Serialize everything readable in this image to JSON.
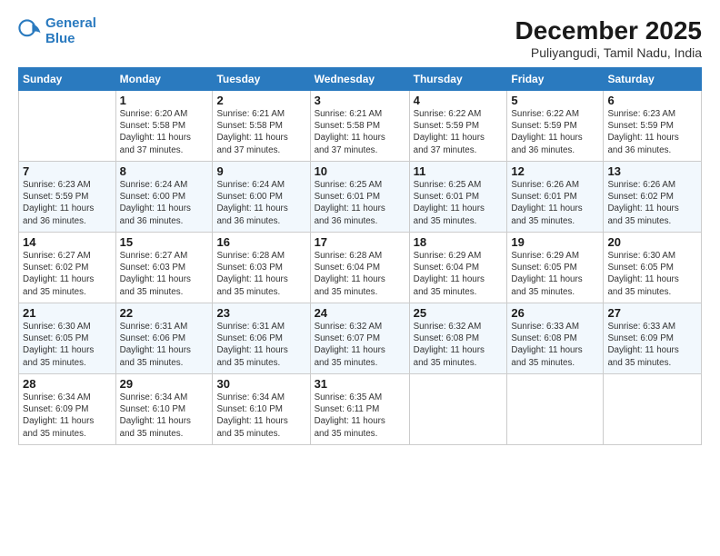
{
  "header": {
    "logo_line1": "General",
    "logo_line2": "Blue",
    "month": "December 2025",
    "location": "Puliyangudi, Tamil Nadu, India"
  },
  "days_of_week": [
    "Sunday",
    "Monday",
    "Tuesday",
    "Wednesday",
    "Thursday",
    "Friday",
    "Saturday"
  ],
  "weeks": [
    [
      {
        "day": "",
        "info": ""
      },
      {
        "day": "1",
        "info": "Sunrise: 6:20 AM\nSunset: 5:58 PM\nDaylight: 11 hours\nand 37 minutes."
      },
      {
        "day": "2",
        "info": "Sunrise: 6:21 AM\nSunset: 5:58 PM\nDaylight: 11 hours\nand 37 minutes."
      },
      {
        "day": "3",
        "info": "Sunrise: 6:21 AM\nSunset: 5:58 PM\nDaylight: 11 hours\nand 37 minutes."
      },
      {
        "day": "4",
        "info": "Sunrise: 6:22 AM\nSunset: 5:59 PM\nDaylight: 11 hours\nand 37 minutes."
      },
      {
        "day": "5",
        "info": "Sunrise: 6:22 AM\nSunset: 5:59 PM\nDaylight: 11 hours\nand 36 minutes."
      },
      {
        "day": "6",
        "info": "Sunrise: 6:23 AM\nSunset: 5:59 PM\nDaylight: 11 hours\nand 36 minutes."
      }
    ],
    [
      {
        "day": "7",
        "info": "Sunrise: 6:23 AM\nSunset: 5:59 PM\nDaylight: 11 hours\nand 36 minutes."
      },
      {
        "day": "8",
        "info": "Sunrise: 6:24 AM\nSunset: 6:00 PM\nDaylight: 11 hours\nand 36 minutes."
      },
      {
        "day": "9",
        "info": "Sunrise: 6:24 AM\nSunset: 6:00 PM\nDaylight: 11 hours\nand 36 minutes."
      },
      {
        "day": "10",
        "info": "Sunrise: 6:25 AM\nSunset: 6:01 PM\nDaylight: 11 hours\nand 36 minutes."
      },
      {
        "day": "11",
        "info": "Sunrise: 6:25 AM\nSunset: 6:01 PM\nDaylight: 11 hours\nand 35 minutes."
      },
      {
        "day": "12",
        "info": "Sunrise: 6:26 AM\nSunset: 6:01 PM\nDaylight: 11 hours\nand 35 minutes."
      },
      {
        "day": "13",
        "info": "Sunrise: 6:26 AM\nSunset: 6:02 PM\nDaylight: 11 hours\nand 35 minutes."
      }
    ],
    [
      {
        "day": "14",
        "info": "Sunrise: 6:27 AM\nSunset: 6:02 PM\nDaylight: 11 hours\nand 35 minutes."
      },
      {
        "day": "15",
        "info": "Sunrise: 6:27 AM\nSunset: 6:03 PM\nDaylight: 11 hours\nand 35 minutes."
      },
      {
        "day": "16",
        "info": "Sunrise: 6:28 AM\nSunset: 6:03 PM\nDaylight: 11 hours\nand 35 minutes."
      },
      {
        "day": "17",
        "info": "Sunrise: 6:28 AM\nSunset: 6:04 PM\nDaylight: 11 hours\nand 35 minutes."
      },
      {
        "day": "18",
        "info": "Sunrise: 6:29 AM\nSunset: 6:04 PM\nDaylight: 11 hours\nand 35 minutes."
      },
      {
        "day": "19",
        "info": "Sunrise: 6:29 AM\nSunset: 6:05 PM\nDaylight: 11 hours\nand 35 minutes."
      },
      {
        "day": "20",
        "info": "Sunrise: 6:30 AM\nSunset: 6:05 PM\nDaylight: 11 hours\nand 35 minutes."
      }
    ],
    [
      {
        "day": "21",
        "info": "Sunrise: 6:30 AM\nSunset: 6:05 PM\nDaylight: 11 hours\nand 35 minutes."
      },
      {
        "day": "22",
        "info": "Sunrise: 6:31 AM\nSunset: 6:06 PM\nDaylight: 11 hours\nand 35 minutes."
      },
      {
        "day": "23",
        "info": "Sunrise: 6:31 AM\nSunset: 6:06 PM\nDaylight: 11 hours\nand 35 minutes."
      },
      {
        "day": "24",
        "info": "Sunrise: 6:32 AM\nSunset: 6:07 PM\nDaylight: 11 hours\nand 35 minutes."
      },
      {
        "day": "25",
        "info": "Sunrise: 6:32 AM\nSunset: 6:08 PM\nDaylight: 11 hours\nand 35 minutes."
      },
      {
        "day": "26",
        "info": "Sunrise: 6:33 AM\nSunset: 6:08 PM\nDaylight: 11 hours\nand 35 minutes."
      },
      {
        "day": "27",
        "info": "Sunrise: 6:33 AM\nSunset: 6:09 PM\nDaylight: 11 hours\nand 35 minutes."
      }
    ],
    [
      {
        "day": "28",
        "info": "Sunrise: 6:34 AM\nSunset: 6:09 PM\nDaylight: 11 hours\nand 35 minutes."
      },
      {
        "day": "29",
        "info": "Sunrise: 6:34 AM\nSunset: 6:10 PM\nDaylight: 11 hours\nand 35 minutes."
      },
      {
        "day": "30",
        "info": "Sunrise: 6:34 AM\nSunset: 6:10 PM\nDaylight: 11 hours\nand 35 minutes."
      },
      {
        "day": "31",
        "info": "Sunrise: 6:35 AM\nSunset: 6:11 PM\nDaylight: 11 hours\nand 35 minutes."
      },
      {
        "day": "",
        "info": ""
      },
      {
        "day": "",
        "info": ""
      },
      {
        "day": "",
        "info": ""
      }
    ]
  ]
}
